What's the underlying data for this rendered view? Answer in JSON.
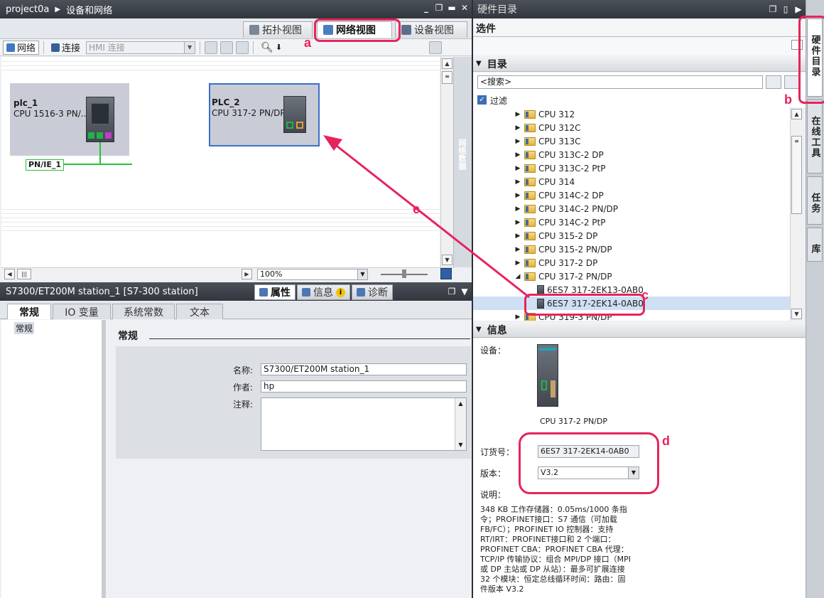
{
  "left_window": {
    "project": "project0a",
    "breadcrumb": "设备和网络",
    "view_tabs": [
      "拓扑视图",
      "网络视图",
      "设备视图"
    ],
    "toolbar": {
      "network": "网络",
      "connections": "连接",
      "connection_type": "HMI 连接"
    },
    "canvas": {
      "stations": [
        {
          "name": "plc_1",
          "cpu": "CPU 1516-3 PN/..."
        },
        {
          "name": "PLC_2",
          "cpu": "CPU 317-2 PN/DP"
        }
      ],
      "subnet": "PN/IE_1",
      "side_label": "网络数据"
    },
    "zoom": "100%"
  },
  "properties": {
    "title": "S7300/ET200M station_1 [S7-300 station]",
    "tabs": [
      "属性",
      "信息",
      "诊断"
    ],
    "sub_tabs": [
      "常规",
      "IO 变量",
      "系统常数",
      "文本"
    ],
    "nav_item": "常规",
    "section": "常规",
    "fields": {
      "name_label": "名称:",
      "name_value": "S7300/ET200M station_1",
      "author_label": "作者:",
      "author_value": "hp",
      "comment_label": "注释:"
    }
  },
  "catalog": {
    "title": "硬件目录",
    "options": "选件",
    "section_catalog": "目录",
    "search_placeholder": "<搜索>",
    "filter": "过滤",
    "items": [
      {
        "label": "CPU 312",
        "type": "folder",
        "expanded": false
      },
      {
        "label": "CPU 312C",
        "type": "folder",
        "expanded": false
      },
      {
        "label": "CPU 313C",
        "type": "folder",
        "expanded": false
      },
      {
        "label": "CPU 313C-2 DP",
        "type": "folder",
        "expanded": false
      },
      {
        "label": "CPU 313C-2 PtP",
        "type": "folder",
        "expanded": false
      },
      {
        "label": "CPU 314",
        "type": "folder",
        "expanded": false
      },
      {
        "label": "CPU 314C-2 DP",
        "type": "folder",
        "expanded": false
      },
      {
        "label": "CPU 314C-2 PN/DP",
        "type": "folder",
        "expanded": false
      },
      {
        "label": "CPU 314C-2 PtP",
        "type": "folder",
        "expanded": false
      },
      {
        "label": "CPU 315-2 DP",
        "type": "folder",
        "expanded": false
      },
      {
        "label": "CPU 315-2 PN/DP",
        "type": "folder",
        "expanded": false
      },
      {
        "label": "CPU 317-2 DP",
        "type": "folder",
        "expanded": false
      },
      {
        "label": "CPU 317-2 PN/DP",
        "type": "folder",
        "expanded": true
      },
      {
        "label": "6ES7 317-2EK13-0AB0",
        "type": "device",
        "expanded": false
      },
      {
        "label": "6ES7 317-2EK14-0AB0",
        "type": "device",
        "expanded": false
      },
      {
        "label": "CPU 319-3 PN/DP",
        "type": "folder",
        "expanded": false
      }
    ],
    "section_info": "信息",
    "info": {
      "device_label": "设备：",
      "device_name": "CPU 317-2 PN/DP",
      "order_label": "订货号：",
      "order_value": "6ES7 317-2EK14-0AB0",
      "version_label": "版本：",
      "version_value": "V3.2",
      "desc_label": "说明：",
      "description": "348 KB 工作存储器：0.05ms/1000 条指\n令；PROFINET接口：S7 通信（可加载\nFB/FC）；PROFINET IO 控制器：支持\nRT/IRT：PROFINET接口和 2 个端口：\nPROFINET CBA：PROFINET CBA 代理：\nTCP/IP 传输协议：组合 MPI/DP 接口（MPI\n或 DP 主站或 DP 从站）：最多可扩展连接\n32 个模块：恒定总线循环时间：路由：固\n件版本 V3.2"
    }
  },
  "side_tabs": [
    "硬件目录",
    "在线工具",
    "任务",
    "库"
  ],
  "annotations": [
    "a",
    "b",
    "c",
    "d",
    "e"
  ],
  "colors": {
    "highlight": "#e6245c",
    "selection_border": "#3c6fc8",
    "subnet": "#26c23a"
  }
}
